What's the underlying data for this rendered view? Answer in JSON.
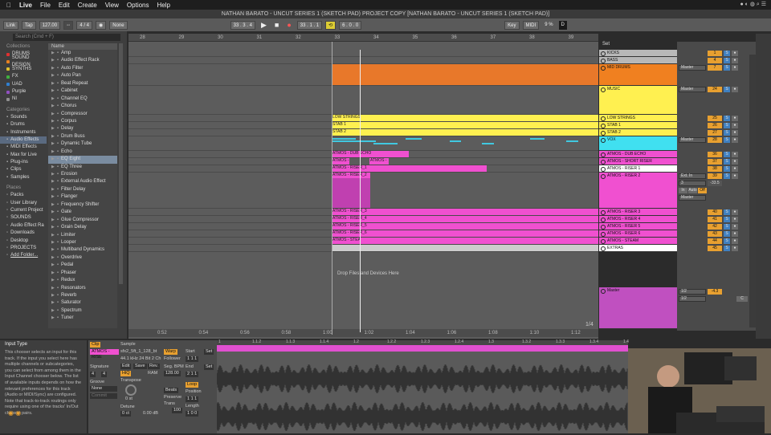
{
  "menubar": {
    "apple": "",
    "app": "Live",
    "items": [
      "File",
      "Edit",
      "Create",
      "View",
      "Options",
      "Help"
    ]
  },
  "title": "NATHAN BARATO - UNCUT SERIES 1 (SKETCH PAD) PROJECT COPY  [NATHAN BARATO - UNCUT SERIES 1 (SKETCH PAD)]",
  "transport": {
    "link": "Link",
    "tap": "Tap",
    "tempo": "127.00",
    "time_sig": "4 / 4",
    "quantize": "None",
    "position": "33 .  3 .  4",
    "arrangement_pos": "33 .  1 .  1",
    "loop_length": "6 .  0 .  0",
    "key": "Key",
    "midi": "MIDI",
    "cpu": "9 %",
    "draw": "D"
  },
  "browser": {
    "search": "Search (Cmd + F)",
    "collections_header": "Collections",
    "collections": [
      {
        "label": "DRUMS",
        "color": "#e03030"
      },
      {
        "label": "SOUND DESIGN",
        "color": "#e88020"
      },
      {
        "label": "SYNTHS",
        "color": "#e0c030"
      },
      {
        "label": "FX",
        "color": "#40b040"
      },
      {
        "label": "UAD",
        "color": "#3080d0"
      },
      {
        "label": "Purple",
        "color": "#9050c0"
      },
      {
        "label": "NI",
        "color": "#909090"
      }
    ],
    "categories_header": "Categories",
    "categories": [
      "Sounds",
      "Drums",
      "Instruments",
      "Audio Effects",
      "MIDI Effects",
      "Max for Live",
      "Plug-ins",
      "Clips",
      "Samples"
    ],
    "places_header": "Places",
    "places": [
      "Packs",
      "User Library",
      "Current Project",
      "SOUNDS",
      "Audio Effect Ra",
      "Downloads",
      "Desktop",
      "PROJECTS",
      "Add Folder..."
    ],
    "name_header": "Name",
    "files": [
      "Amp",
      "Audio Effect Rack",
      "Auto Filter",
      "Auto Pan",
      "Beat Repeat",
      "Cabinet",
      "Channel EQ",
      "Chorus",
      "Compressor",
      "Corpus",
      "Delay",
      "Drum Buss",
      "Dynamic Tube",
      "Echo",
      "EQ Eight",
      "EQ Three",
      "Erosion",
      "External Audio Effect",
      "Filter Delay",
      "Flanger",
      "Frequency Shifter",
      "Gate",
      "Glue Compressor",
      "Grain Delay",
      "Limiter",
      "Looper",
      "Multiband Dynamics",
      "Overdrive",
      "Pedal",
      "Phaser",
      "Redux",
      "Resonators",
      "Reverb",
      "Saturator",
      "Spectrum",
      "Tuner"
    ]
  },
  "ruler": {
    "bars": [
      "28",
      "29",
      "30",
      "31",
      "32",
      "33",
      "34",
      "35",
      "36",
      "37",
      "38",
      "39"
    ],
    "set_label": "Set"
  },
  "bottom_ruler": {
    "times": [
      "0:52",
      "0:54",
      "0:56",
      "0:58",
      "1:00",
      "1:02",
      "1:04",
      "1:06",
      "1:08",
      "1:10",
      "1:12"
    ]
  },
  "page_indicator": "1/4",
  "drop_zone": "Drop Files and Devices Here",
  "tracks": [
    {
      "name": "KICKS",
      "color": "#b8b8b8"
    },
    {
      "name": "BASS",
      "color": "#b8b8b8"
    },
    {
      "name": "MID DRUMS",
      "color": "#f08020"
    },
    {
      "name": "MUSIC",
      "color": "#fff050"
    },
    {
      "name": "LOW STRINGS",
      "color": "#fff050"
    },
    {
      "name": "STAB 1",
      "color": "#fff050"
    },
    {
      "name": "STAB 2",
      "color": "#fff050"
    },
    {
      "name": "VOX",
      "color": "#40e0f0"
    },
    {
      "name": "ATMOS - DUB ECHO",
      "color": "#f050d0"
    },
    {
      "name": "ATMOS - SHORT RISER",
      "color": "#f050d0"
    },
    {
      "name": "ATMOS - RISER 1",
      "color": "#ffffff"
    },
    {
      "name": "ATMOS - RISER 2",
      "color": "#f050d0"
    },
    {
      "name": "ATMOS - RISER 3",
      "color": "#f050d0"
    },
    {
      "name": "ATMOS - RISER 4",
      "color": "#f050d0"
    },
    {
      "name": "ATMOS - RISER 5",
      "color": "#f050d0"
    },
    {
      "name": "ATMOS - RISER 6",
      "color": "#f050d0"
    },
    {
      "name": "ATMOS - STEAM",
      "color": "#f050d0"
    },
    {
      "name": "EXTRAS",
      "color": "#ffffff"
    }
  ],
  "master": {
    "name": "Master",
    "color": "#c050c0",
    "routing": "1/2",
    "volume": "-4.3",
    "pan": "C"
  },
  "clips": {
    "low_strings": "LOW STRINGS",
    "stab1": "STAB 1",
    "stab2": "STAB 2",
    "dub_echo": "ATMOS - DUB ECHO",
    "atmos_a": "ATMOS -",
    "atmos_b": "ATMOS -",
    "riser1": "ATMOS - RISER_1",
    "riser2": "ATMOS - RISER_2",
    "riser3": "ATMOS - RISER_3",
    "riser4": "ATMOS - RISER_4",
    "riser5": "ATMOS - RISER_5",
    "riser6": "ATMOS - RISER_6",
    "steam": "ATMOS - STEA"
  },
  "mixer": {
    "track_numbers": [
      "1",
      "4",
      "7",
      "24",
      "25",
      "26",
      "27",
      "28",
      "36",
      "37",
      "38",
      "39",
      "40",
      "41",
      "42",
      "43",
      "44",
      "45"
    ],
    "routing_master": "Master",
    "riser2_input": "Ext. In",
    "riser2_channel": "3",
    "riser2_vol": "-33.5",
    "monitor": [
      "In",
      "Auto",
      "Off"
    ],
    "pan": "C",
    "solo": "S"
  },
  "info": {
    "title": "Input Type",
    "text": "This chooser selects an input for this track. If the input you select here has multiple channels or subcategories, you can select from among them in the Input Channel chooser below. The list of available inputs depends on how the relevant preferences for this track (Audio or MIDI/Sync) are configured. Note that track-to-track routings only require using one of the tracks' In/Out chooser pairs."
  },
  "clip_view": {
    "clip_label": "Clip",
    "sample_label": "Sample",
    "clip_name": "ATMOS - RISE",
    "sample_name": "sfx2_5ft_1_128_bt",
    "sample_info": "44.1 kHz 24 Bit 2 Ch",
    "warp": "Warp",
    "follower": "Follower",
    "edit": "Edit",
    "save": "Save",
    "rev": "Rev.",
    "hiq": "HiQ",
    "ram": "RAM",
    "signature_label": "Signature",
    "sig_num": "4",
    "sig_den": "4",
    "groove_label": "Groove",
    "groove_val": "None",
    "commit": "Commit",
    "transpose_label": "Transpose",
    "transpose_val": "0 st",
    "detune_label": "Detune",
    "detune_val": "0 ct",
    "gain_val": "0.00 dB",
    "seg_bpm_label": "Seg. BPM",
    "seg_bpm": "128.00",
    "start_label": "Start",
    "start_val": "1  1  1",
    "end_label": "End",
    "end_val": "2  1  1",
    "loop_label": "Loop",
    "position_label": "Position",
    "position_val": "1  1  1",
    "length_label": "Length",
    "length_val": "1  0  0",
    "warp_mode": "Beats",
    "preserve_label": "Preserve",
    "trans_label": "Trans",
    "env_val": "100",
    "set_btn": "Set"
  },
  "wave_ruler": [
    "1",
    "1.1.2",
    "1.1.3",
    "1.1.4",
    "1.2",
    "1.2.2",
    "1.2.3",
    "1.2.4",
    "1.3",
    "1.3.2",
    "1.3.3",
    "1.3.4",
    "1.4"
  ]
}
